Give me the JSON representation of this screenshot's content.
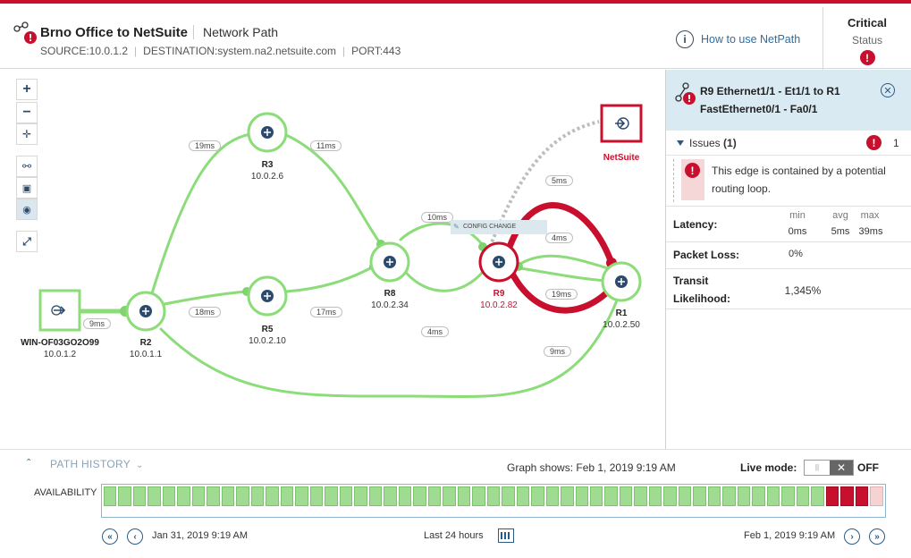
{
  "header": {
    "title": "Brno Office to NetSuite",
    "subtitle": "Network Path",
    "source": "SOURCE:10.0.1.2",
    "destination": "DESTINATION:system.na2.netsuite.com",
    "port": "PORT:443",
    "help_link": "How to use NetPath",
    "status_value": "Critical",
    "status_label": "Status"
  },
  "nodes": {
    "source": {
      "name": "WIN-OF03GO2O99",
      "ip": "10.0.1.2"
    },
    "r2": {
      "name": "R2",
      "ip": "10.0.1.1"
    },
    "r3": {
      "name": "R3",
      "ip": "10.0.2.6"
    },
    "r5": {
      "name": "R5",
      "ip": "10.0.2.10"
    },
    "r8": {
      "name": "R8",
      "ip": "10.0.2.34"
    },
    "r9": {
      "name": "R9",
      "ip": "10.0.2.82"
    },
    "r1": {
      "name": "R1",
      "ip": "10.0.2.50"
    },
    "dest": {
      "name": "NetSuite"
    }
  },
  "edges": {
    "src_r2": "9ms",
    "r2_r3": "19ms",
    "r3_r8": "11ms",
    "r2_r5": "18ms",
    "r5_r8": "17ms",
    "r8_r9_top": "10ms",
    "r8_r9_bottom": "4ms",
    "r9_dest": "5ms",
    "r9_r1_a": "4ms",
    "r9_r1_b": "19ms",
    "r2_r1": "9ms"
  },
  "config_change": "CONFIG CHANGE",
  "panel": {
    "title": "R9 Ethernet1/1 - Et1/1 to R1 FastEthernet0/1 - Fa0/1",
    "issues_label": "Issues",
    "issues_count_paren": "(1)",
    "issues_count": "1",
    "issue_text_1": "This edge is contained by a potential",
    "issue_text_2": "routing loop.",
    "latency_label": "Latency:",
    "min_label": "min",
    "avg_label": "avg",
    "max_label": "max",
    "min_value": "0ms",
    "avg_value": "5ms",
    "max_value": "39ms",
    "packet_loss_label": "Packet Loss:",
    "packet_loss_value": "0%",
    "transit_label_1": "Transit",
    "transit_label_2": "Likelihood:",
    "transit_value": "1,345%"
  },
  "history": {
    "label": "PATH HISTORY",
    "graph_shows": "Graph shows: Feb 1, 2019 9:19 AM",
    "live_mode_label": "Live mode:",
    "live_mode_state": "OFF",
    "availability_label": "AVAILABILITY",
    "availability_cells": [
      "ok",
      "ok",
      "ok",
      "ok",
      "ok",
      "ok",
      "ok",
      "ok",
      "ok",
      "ok",
      "ok",
      "ok",
      "ok",
      "ok",
      "ok",
      "ok",
      "ok",
      "ok",
      "ok",
      "ok",
      "ok",
      "ok",
      "ok",
      "ok",
      "ok",
      "ok",
      "ok",
      "ok",
      "ok",
      "ok",
      "ok",
      "ok",
      "ok",
      "ok",
      "ok",
      "ok",
      "ok",
      "ok",
      "ok",
      "ok",
      "ok",
      "ok",
      "ok",
      "ok",
      "ok",
      "ok",
      "ok",
      "ok",
      "ok",
      "crit",
      "crit",
      "crit",
      "pink"
    ],
    "start_time": "Jan 31, 2019 9:19 AM",
    "range": "Last 24 hours",
    "end_time": "Feb 1, 2019 9:19 AM"
  },
  "colors": {
    "critical": "#c8102e",
    "healthy_edge": "#8cdc7a",
    "accent": "#2b5a85",
    "panel_bg": "#d9eaf3"
  }
}
